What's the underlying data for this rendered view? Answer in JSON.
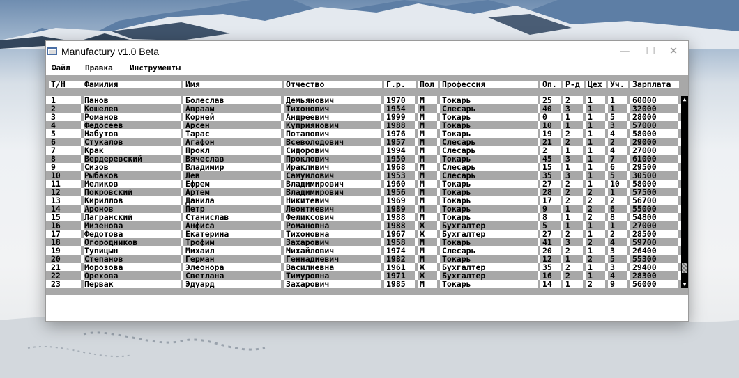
{
  "window": {
    "title": "Manufactury v1.0 Beta",
    "controls": {
      "minimize": "—",
      "maximize": "☐",
      "close": "✕"
    }
  },
  "menu": [
    "Файл",
    "Правка",
    "Инструменты"
  ],
  "columns": [
    "Т/Н",
    "Фамилия",
    "Имя",
    "Отчество",
    "Г.р.",
    "Пол",
    "Профессия",
    "Оп.",
    "Р-д",
    "Цех",
    "Уч.",
    "Зарплата"
  ],
  "rows": [
    [
      "1",
      "Панов",
      "Болеслав",
      "Демьянович",
      "1970",
      "М",
      "Токарь",
      "25",
      "2",
      "1",
      "1",
      "60000"
    ],
    [
      "2",
      "Кошелев",
      "Авраам",
      "Тихонович",
      "1954",
      "М",
      "Слесарь",
      "40",
      "3",
      "1",
      "1",
      "32000"
    ],
    [
      "3",
      "Романов",
      "Корней",
      "Андреевич",
      "1999",
      "М",
      "Токарь",
      "0",
      "1",
      "1",
      "5",
      "28000"
    ],
    [
      "4",
      "Федосеев",
      "Арсен",
      "Куприянович",
      "1988",
      "М",
      "Токарь",
      "10",
      "1",
      "1",
      "3",
      "57000"
    ],
    [
      "5",
      "Набутов",
      "Тарас",
      "Потапович",
      "1976",
      "М",
      "Токарь",
      "19",
      "2",
      "1",
      "4",
      "58000"
    ],
    [
      "6",
      "Стукалов",
      "Агафон",
      "Всеволодович",
      "1957",
      "М",
      "Слесарь",
      "21",
      "2",
      "1",
      "2",
      "29000"
    ],
    [
      "7",
      "Крак",
      "Прокл",
      "Сидорович",
      "1994",
      "М",
      "Слесарь",
      "2",
      "1",
      "1",
      "4",
      "27000"
    ],
    [
      "8",
      "Вердеревский",
      "Вячеслав",
      "Проклович",
      "1950",
      "М",
      "Токарь",
      "45",
      "3",
      "1",
      "7",
      "61000"
    ],
    [
      "9",
      "Сизов",
      "Владимир",
      "Иракливич",
      "1968",
      "М",
      "Слесарь",
      "15",
      "1",
      "1",
      "6",
      "29500"
    ],
    [
      "10",
      "Рыбаков",
      "Лев",
      "Самуилович",
      "1953",
      "М",
      "Слесарь",
      "35",
      "3",
      "1",
      "5",
      "30500"
    ],
    [
      "11",
      "Меликов",
      "Ефрем",
      "Владимирович",
      "1960",
      "М",
      "Токарь",
      "27",
      "2",
      "1",
      "10",
      "58000"
    ],
    [
      "12",
      "Покровский",
      "Артем",
      "Владимирович",
      "1956",
      "М",
      "Токарь",
      "28",
      "2",
      "2",
      "1",
      "57500"
    ],
    [
      "13",
      "Кириллов",
      "Данила",
      "Никитевич",
      "1969",
      "М",
      "Токарь",
      "17",
      "2",
      "2",
      "2",
      "56700"
    ],
    [
      "14",
      "Аронов",
      "Петр",
      "Леонтиевич",
      "1989",
      "М",
      "Токарь",
      "9",
      "1",
      "2",
      "6",
      "55000"
    ],
    [
      "15",
      "Лагранский",
      "Станислав",
      "Феликсович",
      "1988",
      "М",
      "Токарь",
      "8",
      "1",
      "2",
      "8",
      "54800"
    ],
    [
      "16",
      "Мизенова",
      "Анфиса",
      "Романовна",
      "1988",
      "Ж",
      "Бухгалтер",
      "5",
      "1",
      "1",
      "1",
      "27000"
    ],
    [
      "17",
      "Федотова",
      "Екатерина",
      "Тихоновна",
      "1967",
      "Ж",
      "Бухгалтер",
      "27",
      "2",
      "1",
      "2",
      "28500"
    ],
    [
      "18",
      "Огородников",
      "Трофим",
      "Захарович",
      "1958",
      "М",
      "Токарь",
      "41",
      "3",
      "2",
      "4",
      "59700"
    ],
    [
      "19",
      "Тупицын",
      "Михаил",
      "Михайлович",
      "1974",
      "М",
      "Слесарь",
      "20",
      "2",
      "1",
      "3",
      "26400"
    ],
    [
      "20",
      "Степанов",
      "Герман",
      "Геннадиевич",
      "1982",
      "М",
      "Токарь",
      "12",
      "1",
      "2",
      "5",
      "55300"
    ],
    [
      "21",
      "Морозова",
      "Элеонора",
      "Василиевна",
      "1961",
      "Ж",
      "Бухгалтер",
      "35",
      "2",
      "1",
      "3",
      "29400"
    ],
    [
      "22",
      "Орехова",
      "Светлана",
      "Тимуровна",
      "1971",
      "Ж",
      "Бухгалтер",
      "16",
      "2",
      "1",
      "4",
      "28300"
    ],
    [
      "23",
      "Первак",
      "Эдуард",
      "Захарович",
      "1985",
      "М",
      "Токарь",
      "14",
      "1",
      "2",
      "9",
      "56000"
    ]
  ],
  "scrollbar": {
    "up": "▲",
    "down": "▼",
    "position": 0.95
  },
  "icons": {
    "app": "app-window-icon"
  }
}
